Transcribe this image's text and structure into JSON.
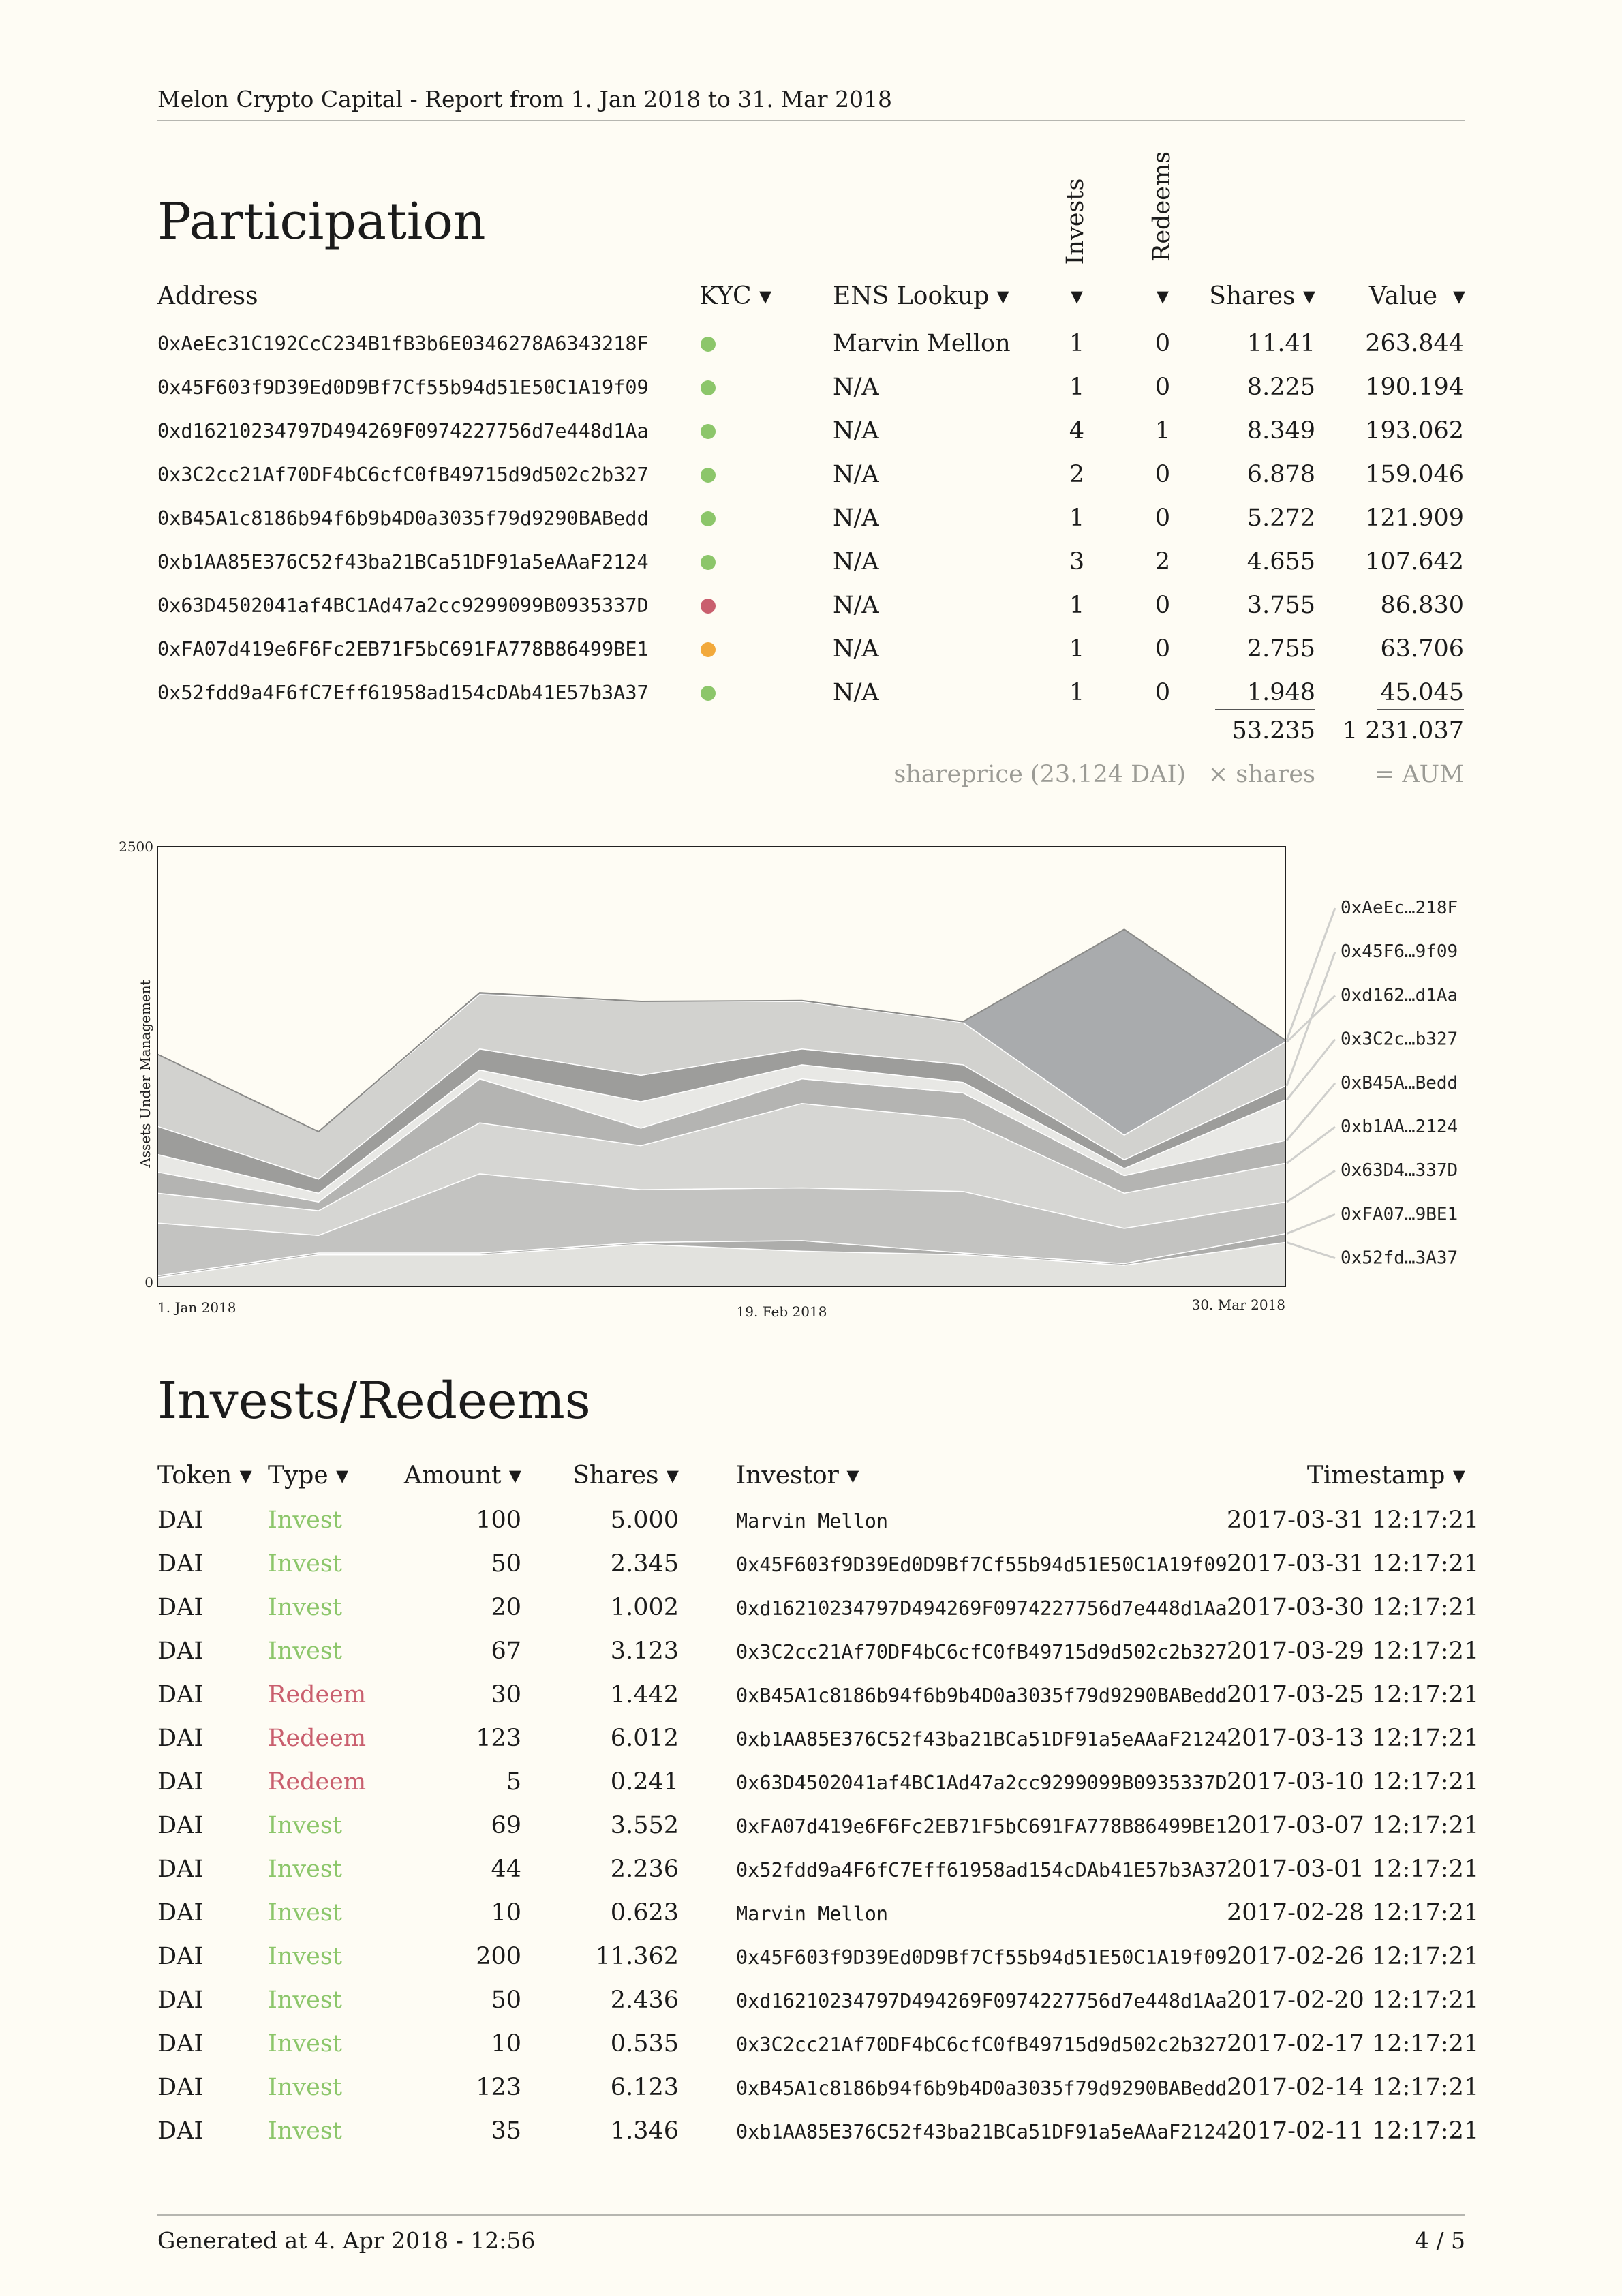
{
  "header": {
    "fund_name": "Melon Crypto Capital",
    "subtitle": " - Report from 1. Jan 2018 to 31. Mar 2018"
  },
  "participation": {
    "title": "Participation",
    "columns": {
      "address": "Address",
      "kyc": "KYC ▾",
      "ens": "ENS Lookup ▾",
      "invests": "Invests",
      "redeems": "Redeems",
      "invests_arrow": "▾",
      "redeems_arrow": "▾",
      "shares": "Shares ▾",
      "value": "Value  ▾"
    },
    "rows": [
      {
        "address": "0xAeEc31C192CcC234B1fB3b6E0346278A6343218F",
        "kyc": "green",
        "ens": "Marvin Mellon",
        "invests": "1",
        "redeems": "0",
        "shares": "11.41",
        "value": "263.844"
      },
      {
        "address": "0x45F603f9D39Ed0D9Bf7Cf55b94d51E50C1A19f09",
        "kyc": "green",
        "ens": "N/A",
        "invests": "1",
        "redeems": "0",
        "shares": "8.225",
        "value": "190.194"
      },
      {
        "address": "0xd16210234797D494269F0974227756d7e448d1Aa",
        "kyc": "green",
        "ens": "N/A",
        "invests": "4",
        "redeems": "1",
        "shares": "8.349",
        "value": "193.062"
      },
      {
        "address": "0x3C2cc21Af70DF4bC6cfC0fB49715d9d502c2b327",
        "kyc": "green",
        "ens": "N/A",
        "invests": "2",
        "redeems": "0",
        "shares": "6.878",
        "value": "159.046"
      },
      {
        "address": "0xB45A1c8186b94f6b9b4D0a3035f79d9290BABedd",
        "kyc": "green",
        "ens": "N/A",
        "invests": "1",
        "redeems": "0",
        "shares": "5.272",
        "value": "121.909"
      },
      {
        "address": "0xb1AA85E376C52f43ba21BCa51DF91a5eAAaF2124",
        "kyc": "green",
        "ens": "N/A",
        "invests": "3",
        "redeems": "2",
        "shares": "4.655",
        "value": "107.642"
      },
      {
        "address": "0x63D4502041af4BC1Ad47a2cc9299099B0935337D",
        "kyc": "red",
        "ens": "N/A",
        "invests": "1",
        "redeems": "0",
        "shares": "3.755",
        "value": "86.830"
      },
      {
        "address": "0xFA07d419e6F6Fc2EB71F5bC691FA778B86499BE1",
        "kyc": "orange",
        "ens": "N/A",
        "invests": "1",
        "redeems": "0",
        "shares": "2.755",
        "value": "63.706"
      },
      {
        "address": "0x52fdd9a4F6fC7Eff61958ad154cDAb41E57b3A37",
        "kyc": "green",
        "ens": "N/A",
        "invests": "1",
        "redeems": "0",
        "shares": "1.948",
        "value": "45.045"
      }
    ],
    "total_shares": "53.235",
    "total_value": "1 231.037",
    "caption_price": "shareprice (23.124 DAI)",
    "caption_shares": "× shares",
    "caption_aum": "= AUM"
  },
  "colors": {
    "kyc_green": "#8cc66a",
    "kyc_red": "#c95f6e",
    "kyc_orange": "#f2a93b",
    "invest": "#8cc66a",
    "redeem": "#c95f6e"
  },
  "chart_data": {
    "type": "area",
    "stacked": true,
    "ylabel": "Assets Under Management",
    "ylim": [
      0,
      2500
    ],
    "y_ticks": [
      "2500",
      "0"
    ],
    "x_ticks": [
      "1. Jan 2018",
      "19. Feb 2018",
      "30. Mar 2018"
    ],
    "x": [
      0,
      1,
      2,
      3,
      4,
      5,
      6,
      7
    ],
    "grid": false,
    "legend_position": "right",
    "series": [
      {
        "name": "0x52fd…3A37",
        "values": [
          50,
          180,
          180,
          240,
          200,
          180,
          120,
          250
        ]
      },
      {
        "name": "0xFA07…9BE1",
        "values": [
          10,
          10,
          10,
          10,
          60,
          10,
          10,
          50
        ]
      },
      {
        "name": "0x63D4…337D",
        "values": [
          300,
          100,
          450,
          300,
          300,
          350,
          200,
          180
        ]
      },
      {
        "name": "0xb1AA…2124",
        "values": [
          170,
          140,
          290,
          250,
          480,
          410,
          200,
          220
        ]
      },
      {
        "name": "0xB45A…Bedd",
        "values": [
          120,
          50,
          250,
          100,
          140,
          150,
          100,
          130
        ]
      },
      {
        "name": "0x3C2c…b327",
        "values": [
          100,
          50,
          50,
          150,
          80,
          60,
          40,
          230
        ]
      },
      {
        "name": "0x45F6…9f09",
        "values": [
          160,
          80,
          120,
          150,
          90,
          100,
          50,
          80
        ]
      },
      {
        "name": "0xd162…d1Aa",
        "values": [
          410,
          270,
          310,
          420,
          270,
          240,
          140,
          250
        ]
      },
      {
        "name": "0xAeEc…218F",
        "values": [
          0,
          0,
          10,
          0,
          5,
          5,
          1170,
          10
        ]
      }
    ],
    "legend_order": [
      "0xAeEc…218F",
      "0x45F6…9f09",
      "0xd162…d1Aa",
      "0x3C2c…b327",
      "0xB45A…Bedd",
      "0xb1AA…2124",
      "0x63D4…337D",
      "0xFA07…9BE1",
      "0x52fd…3A37"
    ]
  },
  "invests_redeems": {
    "title": "Invests/Redeems",
    "columns": {
      "token": "Token ▾",
      "type": "Type ▾",
      "amount": "Amount ▾",
      "shares": "Shares ▾",
      "investor": "Investor ▾",
      "timestamp": "Timestamp ▾"
    },
    "rows": [
      {
        "token": "DAI",
        "type": "Invest",
        "amount": "100",
        "shares": "5.000",
        "investor": "Marvin Mellon",
        "timestamp": "2017-03-31 12:17:21"
      },
      {
        "token": "DAI",
        "type": "Invest",
        "amount": "50",
        "shares": "2.345",
        "investor": "0x45F603f9D39Ed0D9Bf7Cf55b94d51E50C1A19f09",
        "timestamp": "2017-03-31 12:17:21"
      },
      {
        "token": "DAI",
        "type": "Invest",
        "amount": "20",
        "shares": "1.002",
        "investor": "0xd16210234797D494269F0974227756d7e448d1Aa",
        "timestamp": "2017-03-30 12:17:21"
      },
      {
        "token": "DAI",
        "type": "Invest",
        "amount": "67",
        "shares": "3.123",
        "investor": "0x3C2cc21Af70DF4bC6cfC0fB49715d9d502c2b327",
        "timestamp": "2017-03-29 12:17:21"
      },
      {
        "token": "DAI",
        "type": "Redeem",
        "amount": "30",
        "shares": "1.442",
        "investor": "0xB45A1c8186b94f6b9b4D0a3035f79d9290BABedd",
        "timestamp": "2017-03-25 12:17:21"
      },
      {
        "token": "DAI",
        "type": "Redeem",
        "amount": "123",
        "shares": "6.012",
        "investor": "0xb1AA85E376C52f43ba21BCa51DF91a5eAAaF2124",
        "timestamp": "2017-03-13 12:17:21"
      },
      {
        "token": "DAI",
        "type": "Redeem",
        "amount": "5",
        "shares": "0.241",
        "investor": "0x63D4502041af4BC1Ad47a2cc9299099B0935337D",
        "timestamp": "2017-03-10 12:17:21"
      },
      {
        "token": "DAI",
        "type": "Invest",
        "amount": "69",
        "shares": "3.552",
        "investor": "0xFA07d419e6F6Fc2EB71F5bC691FA778B86499BE1",
        "timestamp": "2017-03-07 12:17:21"
      },
      {
        "token": "DAI",
        "type": "Invest",
        "amount": "44",
        "shares": "2.236",
        "investor": "0x52fdd9a4F6fC7Eff61958ad154cDAb41E57b3A37",
        "timestamp": "2017-03-01 12:17:21"
      },
      {
        "token": "DAI",
        "type": "Invest",
        "amount": "10",
        "shares": "0.623",
        "investor": "Marvin Mellon",
        "timestamp": "2017-02-28 12:17:21"
      },
      {
        "token": "DAI",
        "type": "Invest",
        "amount": "200",
        "shares": "11.362",
        "investor": "0x45F603f9D39Ed0D9Bf7Cf55b94d51E50C1A19f09",
        "timestamp": "2017-02-26 12:17:21"
      },
      {
        "token": "DAI",
        "type": "Invest",
        "amount": "50",
        "shares": "2.436",
        "investor": "0xd16210234797D494269F0974227756d7e448d1Aa",
        "timestamp": "2017-02-20 12:17:21"
      },
      {
        "token": "DAI",
        "type": "Invest",
        "amount": "10",
        "shares": "0.535",
        "investor": "0x3C2cc21Af70DF4bC6cfC0fB49715d9d502c2b327",
        "timestamp": "2017-02-17 12:17:21"
      },
      {
        "token": "DAI",
        "type": "Invest",
        "amount": "123",
        "shares": "6.123",
        "investor": "0xB45A1c8186b94f6b9b4D0a3035f79d9290BABedd",
        "timestamp": "2017-02-14 12:17:21"
      },
      {
        "token": "DAI",
        "type": "Invest",
        "amount": "35",
        "shares": "1.346",
        "investor": "0xb1AA85E376C52f43ba21BCa51DF91a5eAAaF2124",
        "timestamp": "2017-02-11 12:17:21"
      }
    ]
  },
  "footer": {
    "generated": "Generated at 4. Apr 2018 - 12:56",
    "page": "4 / 5"
  }
}
